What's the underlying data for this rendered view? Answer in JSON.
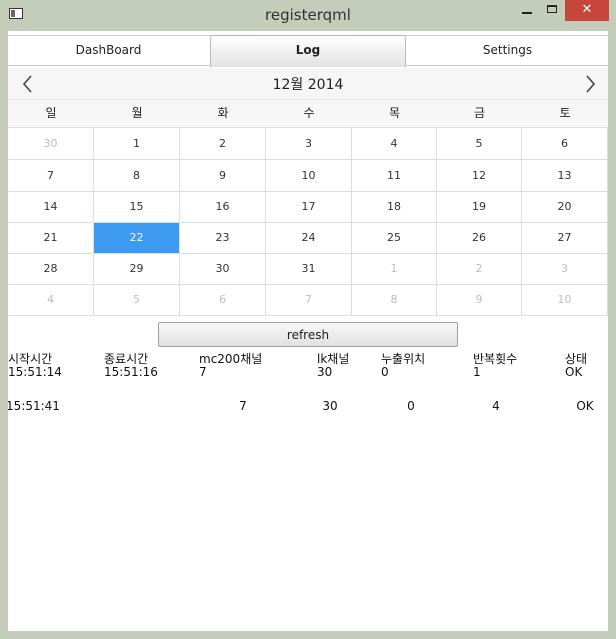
{
  "window": {
    "title": "registerqml",
    "close_glyph": "✕"
  },
  "tabs": [
    {
      "label": "DashBoard",
      "active": false
    },
    {
      "label": "Log",
      "active": true
    },
    {
      "label": "Settings",
      "active": false
    }
  ],
  "calendar": {
    "month_label": "12월 2014",
    "weekdays": [
      "일",
      "월",
      "화",
      "수",
      "목",
      "금",
      "토"
    ],
    "weeks": [
      [
        "30",
        "1",
        "2",
        "3",
        "4",
        "5",
        "6"
      ],
      [
        "7",
        "8",
        "9",
        "10",
        "11",
        "12",
        "13"
      ],
      [
        "14",
        "15",
        "16",
        "17",
        "18",
        "19",
        "20"
      ],
      [
        "21",
        "22",
        "23",
        "24",
        "25",
        "26",
        "27"
      ],
      [
        "28",
        "29",
        "30",
        "31",
        "1",
        "2",
        "3"
      ],
      [
        "4",
        "5",
        "6",
        "7",
        "8",
        "9",
        "10"
      ]
    ],
    "selected_day": "22",
    "colors": {
      "selected": "#3d9af1",
      "outside_month": "#bdbdbd"
    }
  },
  "refresh_label": "refresh",
  "log_table": {
    "headers": [
      "시작시간",
      "종료시간",
      "mc200채널",
      "lk채널",
      "누출위치",
      "반복횟수",
      "상태"
    ],
    "rows": [
      [
        "15:51:14",
        "15:51:16",
        "7",
        "30",
        "0",
        "1",
        "OK"
      ],
      [
        "15:51:41",
        "",
        "7",
        "30",
        "0",
        "4",
        "OK"
      ]
    ]
  }
}
